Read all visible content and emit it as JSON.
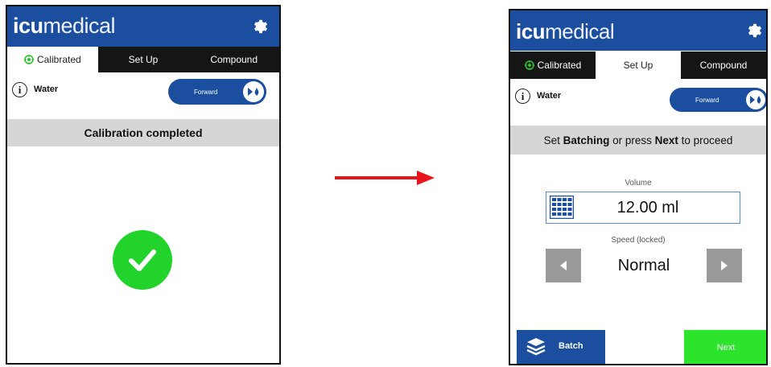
{
  "left_screen": {
    "logo": {
      "bold": "icu",
      "light": "medical"
    },
    "tabs": [
      {
        "label": "Calibrated",
        "active": true
      },
      {
        "label": "Set Up",
        "active": false
      },
      {
        "label": "Compound",
        "active": false
      }
    ],
    "fluid_name": "Water",
    "direction_toggle": {
      "label": "Forward"
    },
    "banner_text": "Calibration completed",
    "status_icon": "check-circle-icon"
  },
  "right_screen": {
    "logo": {
      "bold": "icu",
      "light": "medical"
    },
    "tabs": [
      {
        "label": "Calibrated",
        "active": false
      },
      {
        "label": "Set Up",
        "active": true
      },
      {
        "label": "Compound",
        "active": false
      }
    ],
    "fluid_name": "Water",
    "direction_toggle": {
      "label": "Forward"
    },
    "banner": {
      "part1": "Set ",
      "bold1": "Batching",
      "part2": " or press ",
      "bold2": "Next",
      "part3": " to proceed"
    },
    "volume": {
      "label": "Volume",
      "value": "12.00 ml"
    },
    "speed": {
      "label": "Speed (locked)",
      "value": "Normal"
    },
    "batch_button": "Batch",
    "next_button": "Next"
  },
  "colors": {
    "header_blue": "#1c4ea0",
    "tab_black": "#151515",
    "success_green": "#22d32c",
    "next_green": "#2ce42c",
    "arrow_red": "#e8141b"
  },
  "icons": [
    "gear-icon",
    "calibrated-target-icon",
    "info-icon",
    "drops-icon",
    "check-icon",
    "keypad-icon",
    "arrow-left-icon",
    "arrow-right-icon",
    "layers-icon",
    "right-arrow-icon"
  ]
}
